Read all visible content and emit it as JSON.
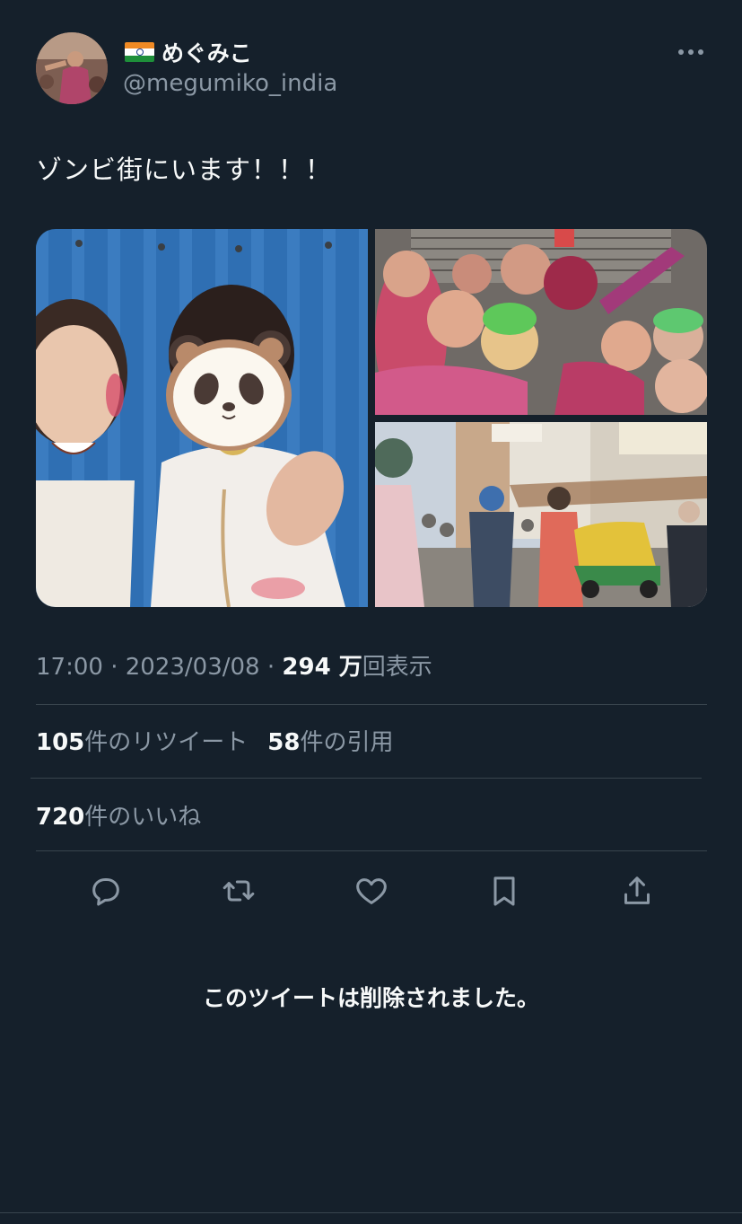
{
  "user": {
    "flag": "🇮🇳",
    "display_name": "めぐみこ",
    "handle": "@megumiko_india"
  },
  "tweet": {
    "text": "ゾンビ街にいます！！！"
  },
  "meta": {
    "time": "17:00",
    "sep1": " · ",
    "date": "2023/03/08",
    "sep2": " · ",
    "views_count": "294 万",
    "views_label": "回表示"
  },
  "stats": {
    "retweets_count": "105",
    "retweets_label": "件のリツイート",
    "quotes_count": "58",
    "quotes_label": "件の引用",
    "likes_count": "720",
    "likes_label": "件のいいね"
  },
  "actions": [
    "reply-icon",
    "retweet-icon",
    "like-icon",
    "bookmark-icon",
    "share-icon"
  ],
  "deleted_notice": "このツイートは削除されました。",
  "colors": {
    "background": "#15202b",
    "primary_text": "#f7f9f9",
    "secondary_text": "#8b98a5",
    "divider": "#38444d"
  }
}
